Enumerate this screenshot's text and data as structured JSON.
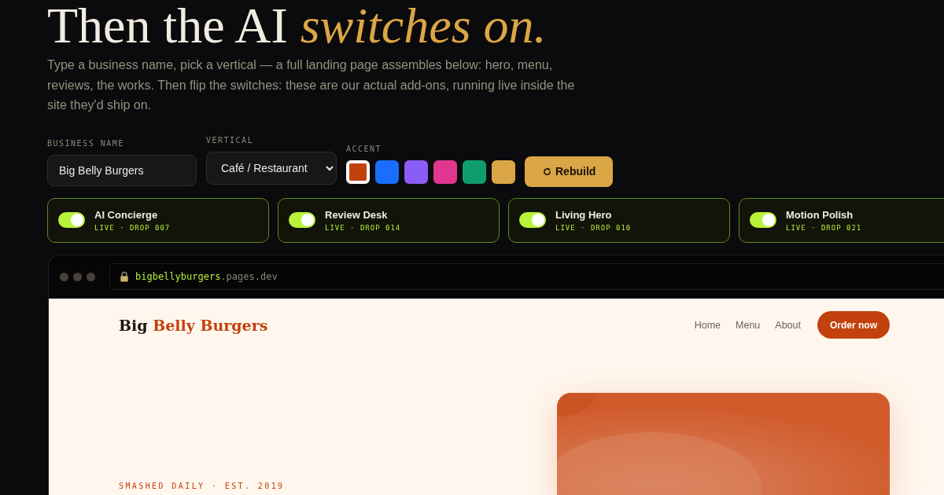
{
  "headline": {
    "lead": "Then the AI",
    "accent": "switches on."
  },
  "intro": "Type a business name, pick a vertical — a full landing page assembles below: hero, menu, reviews, the works. Then flip the switches: these are our actual add-ons, running live inside the site they'd ship on.",
  "controls": {
    "business_name": {
      "label": "BUSINESS NAME",
      "value": "Big Belly Burgers"
    },
    "vertical": {
      "label": "VERTICAL",
      "value": "Café / Restaurant"
    },
    "accent": {
      "label": "ACCENT",
      "swatches": [
        {
          "color": "#c2410c",
          "selected": true
        },
        {
          "color": "#1a6dff",
          "selected": false
        },
        {
          "color": "#8b5cf6",
          "selected": false
        },
        {
          "color": "#e0368f",
          "selected": false
        },
        {
          "color": "#0f9d6e",
          "selected": false
        },
        {
          "color": "#dba645",
          "selected": false
        }
      ]
    },
    "rebuild": "Rebuild"
  },
  "addons": [
    {
      "name": "AI Concierge",
      "status": "LIVE · DROP 007",
      "on": true
    },
    {
      "name": "Review Desk",
      "status": "LIVE · DROP 014",
      "on": true
    },
    {
      "name": "Living Hero",
      "status": "LIVE · DROP 010",
      "on": true
    },
    {
      "name": "Motion Polish",
      "status": "LIVE · DROP 021",
      "on": true
    }
  ],
  "preview": {
    "url": {
      "subdomain": "bigbellyburgers",
      "domain": ".pages.dev"
    },
    "logo": {
      "first": "Big",
      "rest": "Belly Burgers"
    },
    "nav": [
      "Home",
      "Menu",
      "About"
    ],
    "cta": "Order now",
    "eyebrow": "SMASHED DAILY · EST. 2019"
  }
}
